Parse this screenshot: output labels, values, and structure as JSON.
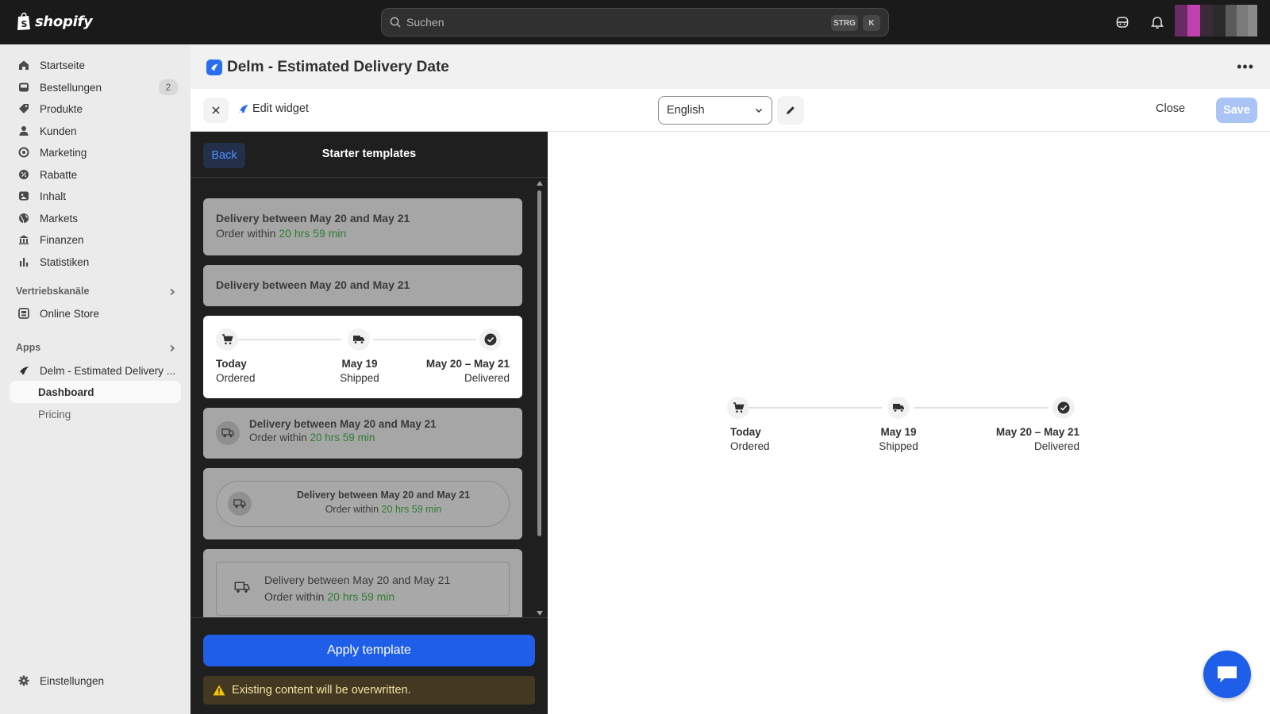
{
  "topbar": {
    "logo_text": "shopify",
    "search_placeholder": "Suchen",
    "shortcut_key1": "STRG",
    "shortcut_key2": "K"
  },
  "sidebar": {
    "items": [
      {
        "label": "Startseite",
        "icon": "home-icon"
      },
      {
        "label": "Bestellungen",
        "icon": "inbox-icon",
        "badge": "2"
      },
      {
        "label": "Produkte",
        "icon": "tag-icon"
      },
      {
        "label": "Kunden",
        "icon": "person-icon"
      },
      {
        "label": "Marketing",
        "icon": "target-icon"
      },
      {
        "label": "Rabatte",
        "icon": "discount-icon"
      },
      {
        "label": "Inhalt",
        "icon": "content-icon"
      },
      {
        "label": "Markets",
        "icon": "globe-icon"
      },
      {
        "label": "Finanzen",
        "icon": "bank-icon"
      },
      {
        "label": "Statistiken",
        "icon": "bar-chart-icon"
      }
    ],
    "sales_channels_label": "Vertriebskanäle",
    "online_store_label": "Online Store",
    "apps_label": "Apps",
    "app_name": "Delm - Estimated Delivery ...",
    "dashboard_label": "Dashboard",
    "pricing_label": "Pricing",
    "settings_label": "Einstellungen"
  },
  "header": {
    "title": "Delm - Estimated Delivery Date"
  },
  "toolbar": {
    "edit_label": "Edit widget",
    "language": "English",
    "close_label": "Close",
    "save_label": "Save"
  },
  "panel": {
    "back_label": "Back",
    "title": "Starter templates",
    "templates": {
      "t1_line1": "Delivery between May 20 and May 21",
      "t1_line2_prefix": "Order within ",
      "t1_line2_time": "20 hrs 59 min",
      "t2_line1": "Delivery between May 20 and May 21",
      "t4_line1": "Delivery between May 20 and May 21",
      "t4_line2_prefix": "Order within ",
      "t4_line2_time": "20 hrs 59 min",
      "t5_line1": "Delivery between May 20 and May 21",
      "t5_line2_prefix": "Order within ",
      "t5_line2_time": "20 hrs 59 min",
      "t6_line1": "Delivery between May 20 and May 21",
      "t6_line2_prefix": "Order within ",
      "t6_line2_time": "20 hrs 59 min"
    },
    "apply_label": "Apply template",
    "warning_text": "Existing content will be overwritten."
  },
  "timeline": {
    "step1_title": "Today",
    "step1_sub": "Ordered",
    "step2_title": "May 19",
    "step2_sub": "Shipped",
    "step3_title": "May 20 – May 21",
    "step3_sub": "Delivered"
  },
  "colors": {
    "accent": "#1f5ee8",
    "highlight_green": "#2e7d32",
    "topbar_bg": "#1a1a1a",
    "panel_bg": "#1f1f1f"
  }
}
